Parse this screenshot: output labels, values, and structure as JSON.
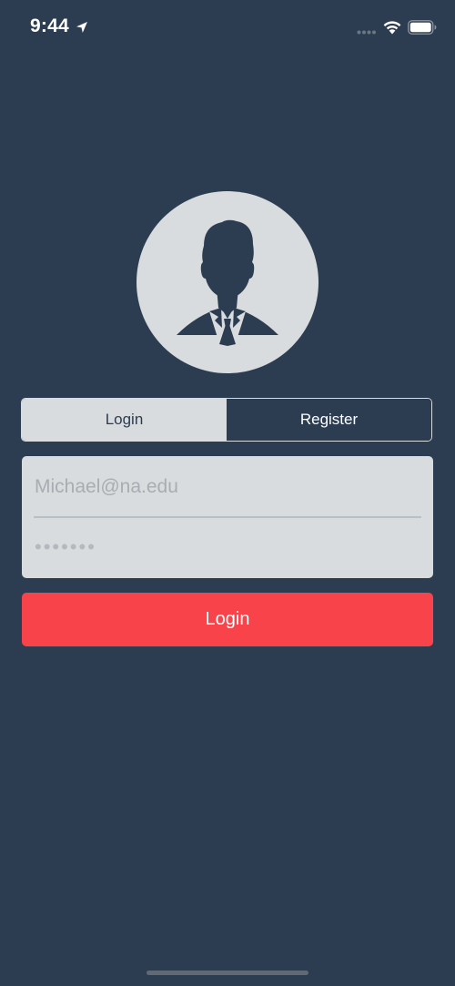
{
  "status_bar": {
    "time": "9:44",
    "icons": [
      "location-arrow-icon",
      "cellular-signal-icon",
      "wifi-icon",
      "battery-icon"
    ]
  },
  "avatar": {
    "icon": "user-silhouette-icon"
  },
  "tabs": [
    {
      "label": "Login",
      "selected": true
    },
    {
      "label": "Register",
      "selected": false
    }
  ],
  "form": {
    "email_placeholder": "Michael@na.edu",
    "email_value": "",
    "password_placeholder": "•••••••",
    "password_value": ""
  },
  "login_button": {
    "label": "Login"
  },
  "colors": {
    "background": "#2d3d51",
    "panel": "#d8dcde",
    "accent": "#f8434a",
    "placeholder": "#a9adb1"
  }
}
